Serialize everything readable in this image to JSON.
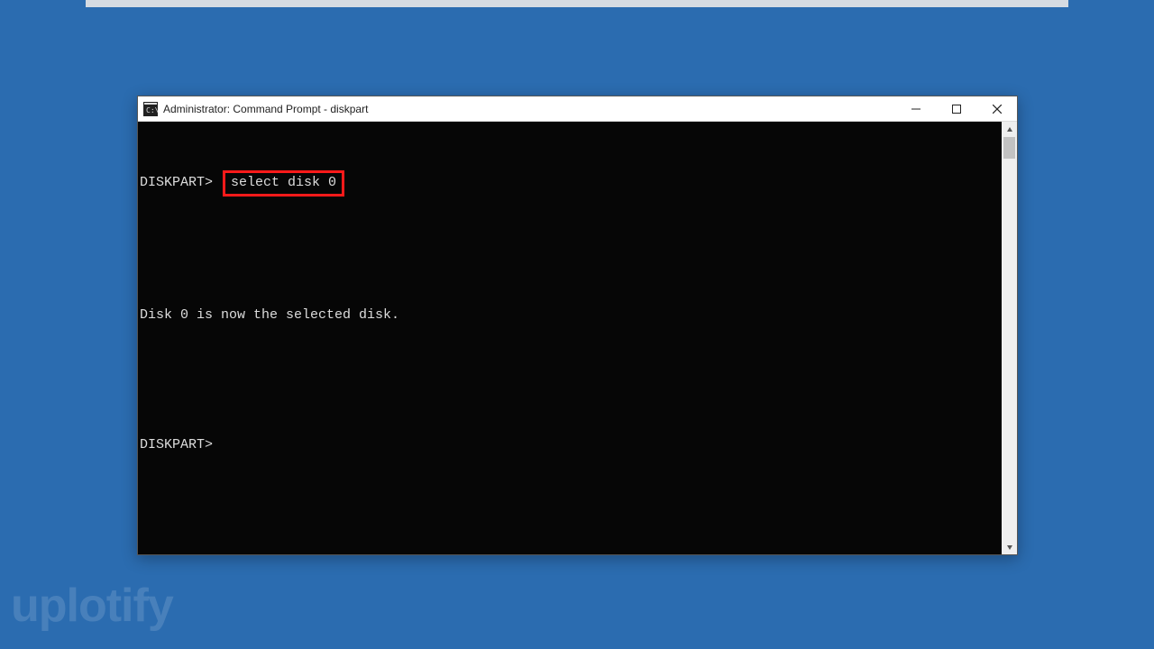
{
  "window": {
    "title": "Administrator: Command Prompt - diskpart"
  },
  "terminal": {
    "prompt1": "DISKPART>",
    "command1": "select disk 0",
    "output1": "Disk 0 is now the selected disk.",
    "prompt2": "DISKPART>"
  },
  "watermark": "uplotify"
}
